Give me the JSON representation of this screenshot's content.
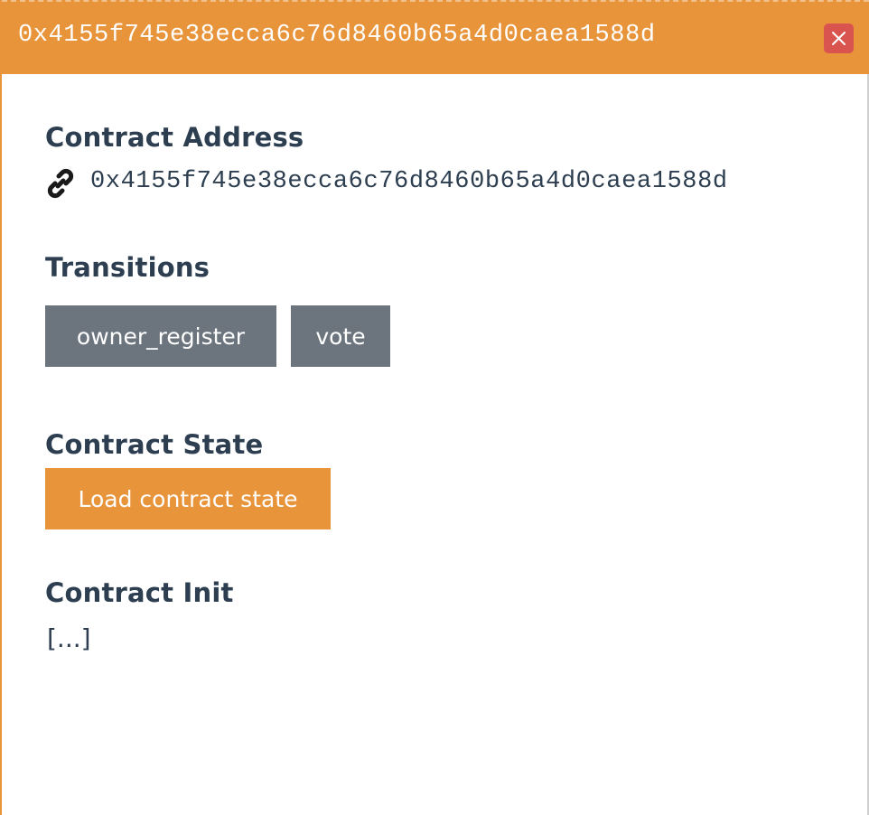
{
  "header": {
    "title": "0x4155f745e38ecca6c76d8460b65a4d0caea1588d",
    "close_icon": "close-icon",
    "accent_color": "#e8943a",
    "close_color": "#d9534f"
  },
  "contract_address": {
    "heading": "Contract Address",
    "icon": "link-icon",
    "address": "0x4155f745e38ecca6c76d8460b65a4d0caea1588d"
  },
  "transitions": {
    "heading": "Transitions",
    "items": [
      {
        "label": "owner_register"
      },
      {
        "label": "vote"
      }
    ],
    "button_color": "#6c757d"
  },
  "contract_state": {
    "heading": "Contract State",
    "load_button_label": "Load contract state"
  },
  "contract_init": {
    "heading": "Contract Init",
    "value": "[...]"
  }
}
